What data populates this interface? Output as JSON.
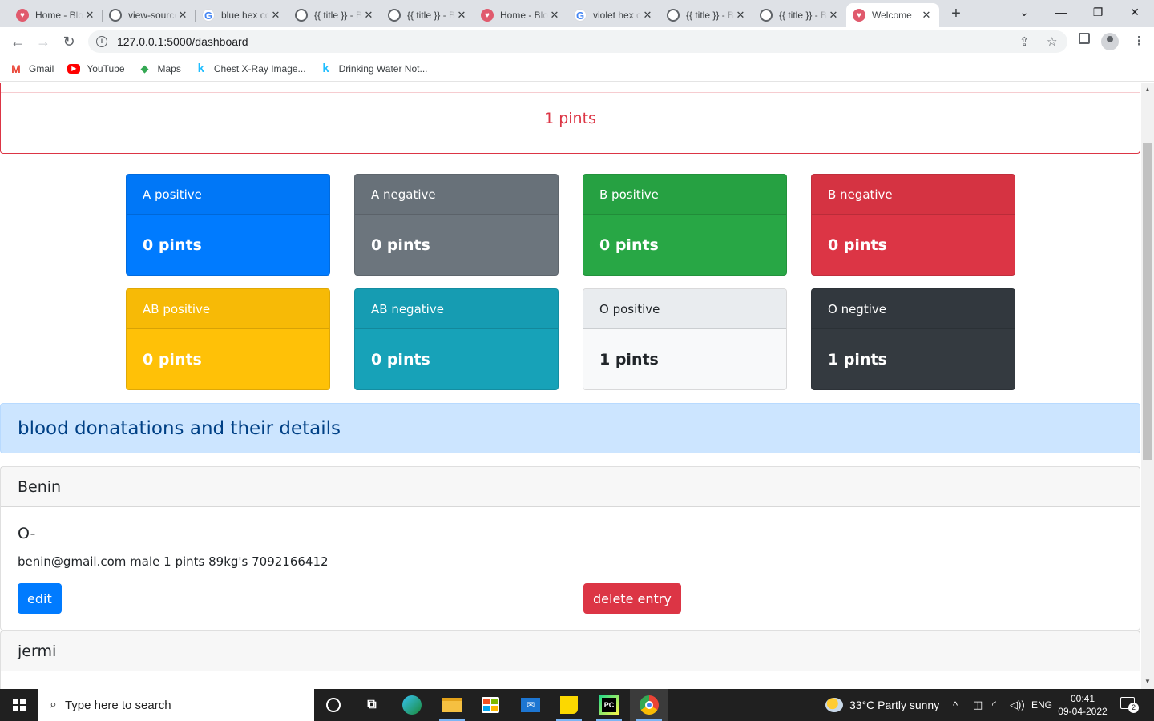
{
  "browser": {
    "tabs": [
      {
        "title": "Home - Blood Bank",
        "icon": "red",
        "glyph": "♥"
      },
      {
        "title": "view-source",
        "icon": "globe",
        "glyph": ""
      },
      {
        "title": "blue hex color",
        "icon": "g",
        "glyph": "G"
      },
      {
        "title": "{{ title }} - Blood",
        "icon": "globe",
        "glyph": ""
      },
      {
        "title": "{{ title }} - Blood",
        "icon": "globe",
        "glyph": ""
      },
      {
        "title": "Home - Blood Bank",
        "icon": "red",
        "glyph": "♥"
      },
      {
        "title": "violet hex color",
        "icon": "g",
        "glyph": "G"
      },
      {
        "title": "{{ title }} - Blood",
        "icon": "globe",
        "glyph": ""
      },
      {
        "title": "{{ title }} - Blood",
        "icon": "globe",
        "glyph": ""
      },
      {
        "title": "Welcome",
        "icon": "red",
        "glyph": "♥"
      }
    ],
    "close_glyph": "✕",
    "new_tab_glyph": "+",
    "window_controls": {
      "dropdown": "⌄",
      "minimize": "—",
      "maximize": "❐",
      "close": "✕"
    },
    "url": "127.0.0.1:5000/dashboard",
    "nav": {
      "back": "←",
      "forward": "→",
      "reload": "↻"
    },
    "bookmarks": [
      {
        "label": "Gmail",
        "icon": "gmail-icon",
        "glyph": "M"
      },
      {
        "label": "YouTube",
        "icon": "youtube-icon",
        "glyph": "▶"
      },
      {
        "label": "Maps",
        "icon": "maps-icon",
        "glyph": "◆"
      },
      {
        "label": "Chest X-Ray Image...",
        "icon": "kaggle-icon",
        "glyph": "k"
      },
      {
        "label": "Drinking Water Not...",
        "icon": "kaggle-icon",
        "glyph": "k"
      }
    ]
  },
  "dashboard": {
    "total": "1 pints",
    "groups": [
      {
        "name": "A positive",
        "value": "0 pints",
        "color": "#007bff"
      },
      {
        "name": "A negative",
        "value": "0 pints",
        "color": "#6c757d"
      },
      {
        "name": "B positive",
        "value": "0 pints",
        "color": "#28a745"
      },
      {
        "name": "B negative",
        "value": "0 pints",
        "color": "#dc3545"
      },
      {
        "name": "AB positive",
        "value": "0 pints",
        "color": "#ffc107"
      },
      {
        "name": "AB negative",
        "value": "0 pints",
        "color": "#17a2b8"
      },
      {
        "name": "O positive",
        "value": "1 pints",
        "color": "#f8f9fa"
      },
      {
        "name": "O negtive",
        "value": "1 pints",
        "color": "#343a40"
      }
    ],
    "section_title": "blood donatations and their details",
    "donors": [
      {
        "name": "Benin",
        "blood_group": "O-",
        "details": "benin@gmail.com male 1 pints 89kg's 7092166412",
        "edit_label": "edit",
        "delete_label": "delete entry"
      },
      {
        "name": "jermi"
      }
    ]
  },
  "taskbar": {
    "search_placeholder": "Type here to search",
    "weather": "33°C  Partly sunny",
    "language": "ENG",
    "time": "00:41",
    "date": "09-04-2022",
    "notification_count": "2"
  }
}
